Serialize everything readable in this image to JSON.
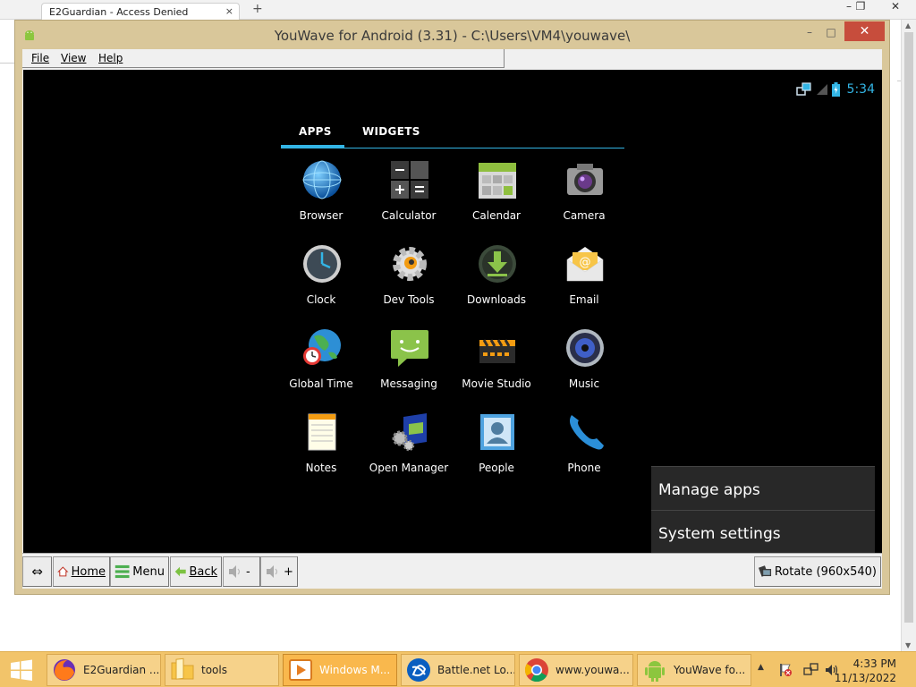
{
  "background_browser": {
    "tab_title": "E2Guardian - Access Denied",
    "tab_close": "×",
    "new_tab": "+",
    "win_min": "–",
    "win_restore": "❐",
    "win_close": "✕"
  },
  "window": {
    "title": "YouWave for Android (3.31) - C:\\Users\\VM4\\youwave\\",
    "min": "–",
    "max": "□",
    "close": "✕"
  },
  "menubar": {
    "items": [
      "File",
      "View",
      "Help"
    ]
  },
  "status_bar": {
    "time": "5:34"
  },
  "drawer": {
    "tabs": [
      "APPS",
      "WIDGETS"
    ],
    "active_tab": "APPS",
    "apps": [
      {
        "label": "Browser",
        "icon": "browser-globe-icon"
      },
      {
        "label": "Calculator",
        "icon": "calculator-icon"
      },
      {
        "label": "Calendar",
        "icon": "calendar-icon"
      },
      {
        "label": "Camera",
        "icon": "camera-icon"
      },
      {
        "label": "Clock",
        "icon": "clock-icon"
      },
      {
        "label": "Dev Tools",
        "icon": "dev-tools-gear-icon"
      },
      {
        "label": "Downloads",
        "icon": "downloads-icon"
      },
      {
        "label": "Email",
        "icon": "email-icon"
      },
      {
        "label": "Global Time",
        "icon": "global-time-icon"
      },
      {
        "label": "Messaging",
        "icon": "messaging-icon"
      },
      {
        "label": "Movie Studio",
        "icon": "movie-studio-icon"
      },
      {
        "label": "Music",
        "icon": "music-speaker-icon"
      },
      {
        "label": "Notes",
        "icon": "notes-icon"
      },
      {
        "label": "Open Manager",
        "icon": "open-manager-icon"
      },
      {
        "label": "People",
        "icon": "people-icon"
      },
      {
        "label": "Phone",
        "icon": "phone-icon"
      }
    ]
  },
  "popup_menu": {
    "items": [
      "Manage apps",
      "System settings"
    ]
  },
  "toolbar": {
    "resize": "⇔",
    "home": "Home",
    "menu": "Menu",
    "back": "Back",
    "vol_down": "-",
    "vol_up": "+",
    "rotate": "Rotate  (960x540)"
  },
  "taskbar": {
    "items": [
      {
        "label": "E2Guardian ...",
        "icon": "firefox-icon"
      },
      {
        "label": "tools",
        "icon": "folder-icon"
      },
      {
        "label": "Windows M...",
        "icon": "media-player-icon"
      },
      {
        "label": "Battle.net Lo...",
        "icon": "battlenet-icon"
      },
      {
        "label": "www.youwa...",
        "icon": "chrome-icon"
      },
      {
        "label": "YouWave fo...",
        "icon": "android-icon"
      }
    ],
    "active_index": 2,
    "clock_time": "4:33 PM",
    "clock_date": "11/13/2022"
  },
  "colors": {
    "accent_holo_blue": "#33b5e5",
    "window_frame": "#d9c79a",
    "taskbar": "#f2c46a",
    "close_red": "#c74d3c"
  }
}
